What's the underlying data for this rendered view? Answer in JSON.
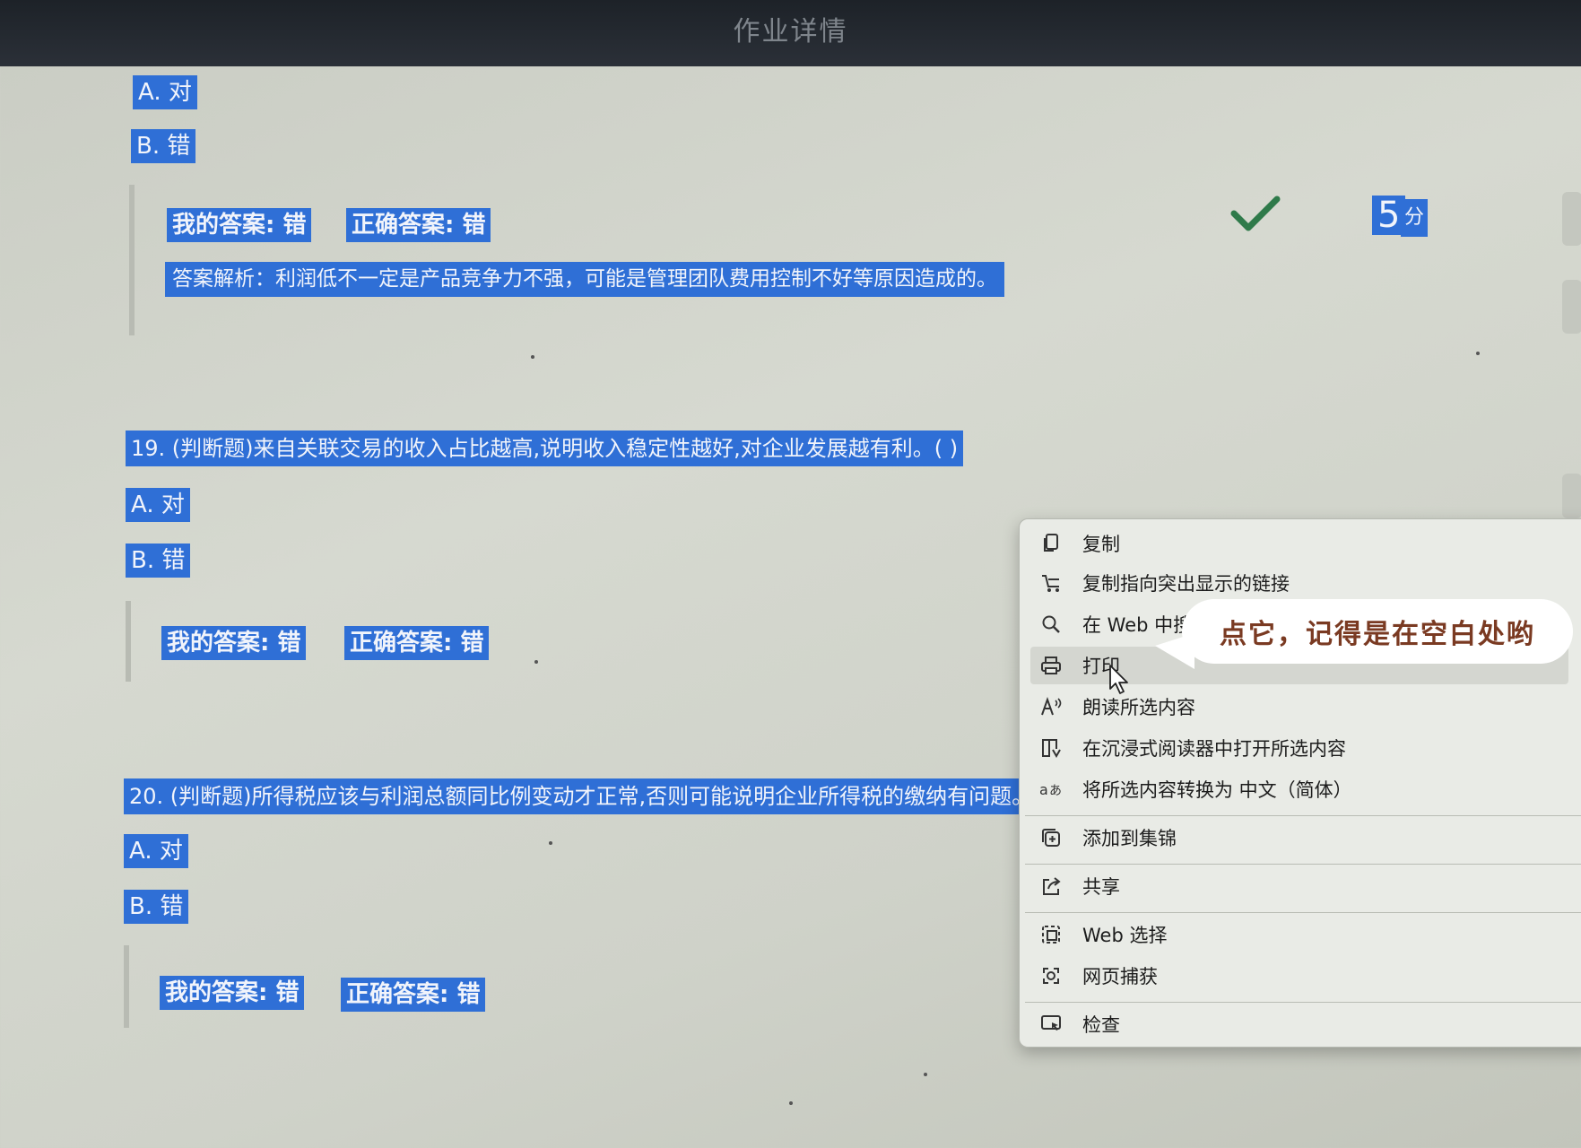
{
  "header": {
    "title": "作业详情"
  },
  "q18": {
    "option_a": "A. 对",
    "option_b": "B. 错",
    "my_answer": "我的答案: 错",
    "correct_answer": "正确答案: 错",
    "analysis": "答案解析：利润低不一定是产品竞争力不强，可能是管理团队费用控制不好等原因造成的。",
    "score": "5",
    "score_unit": "分"
  },
  "q19": {
    "question": "19. (判断题)来自关联交易的收入占比越高,说明收入稳定性越好,对企业发展越有利。( )",
    "option_a": "A. 对",
    "option_b": "B. 错",
    "my_answer": "我的答案: 错",
    "correct_answer": "正确答案: 错"
  },
  "q20": {
    "question": "20. (判断题)所得税应该与利润总额同比例变动才正常,否则可能说明企业所得税的缴纳有问题。",
    "option_a": "A. 对",
    "option_b": "B. 错",
    "my_answer": "我的答案: 错",
    "correct_answer": "正确答案: 错"
  },
  "context_menu": {
    "items": [
      {
        "label": "复制",
        "icon": "copy-icon"
      },
      {
        "label": "复制指向突出显示的链接",
        "icon": "link-icon"
      },
      {
        "label": "在 Web 中搜索",
        "icon": "search-icon"
      },
      {
        "label": "打印",
        "icon": "printer-icon"
      },
      {
        "label": "朗读所选内容",
        "icon": "read-aloud-icon"
      },
      {
        "label": "在沉浸式阅读器中打开所选内容",
        "icon": "immersive-reader-icon"
      },
      {
        "label": "将所选内容转换为 中文（简体）",
        "icon": "translate-icon"
      },
      {
        "label": "添加到集锦",
        "icon": "collections-icon"
      },
      {
        "label": "共享",
        "icon": "share-icon"
      },
      {
        "label": "Web 选择",
        "icon": "web-select-icon"
      },
      {
        "label": "网页捕获",
        "icon": "capture-icon"
      },
      {
        "label": "检查",
        "icon": "inspect-icon"
      }
    ]
  },
  "annotation": {
    "text": "点它，记得是在空白处哟"
  },
  "colors": {
    "selection": "#2f6fd6",
    "check": "#2f7a4a",
    "annotation_text": "#7a3a22"
  }
}
